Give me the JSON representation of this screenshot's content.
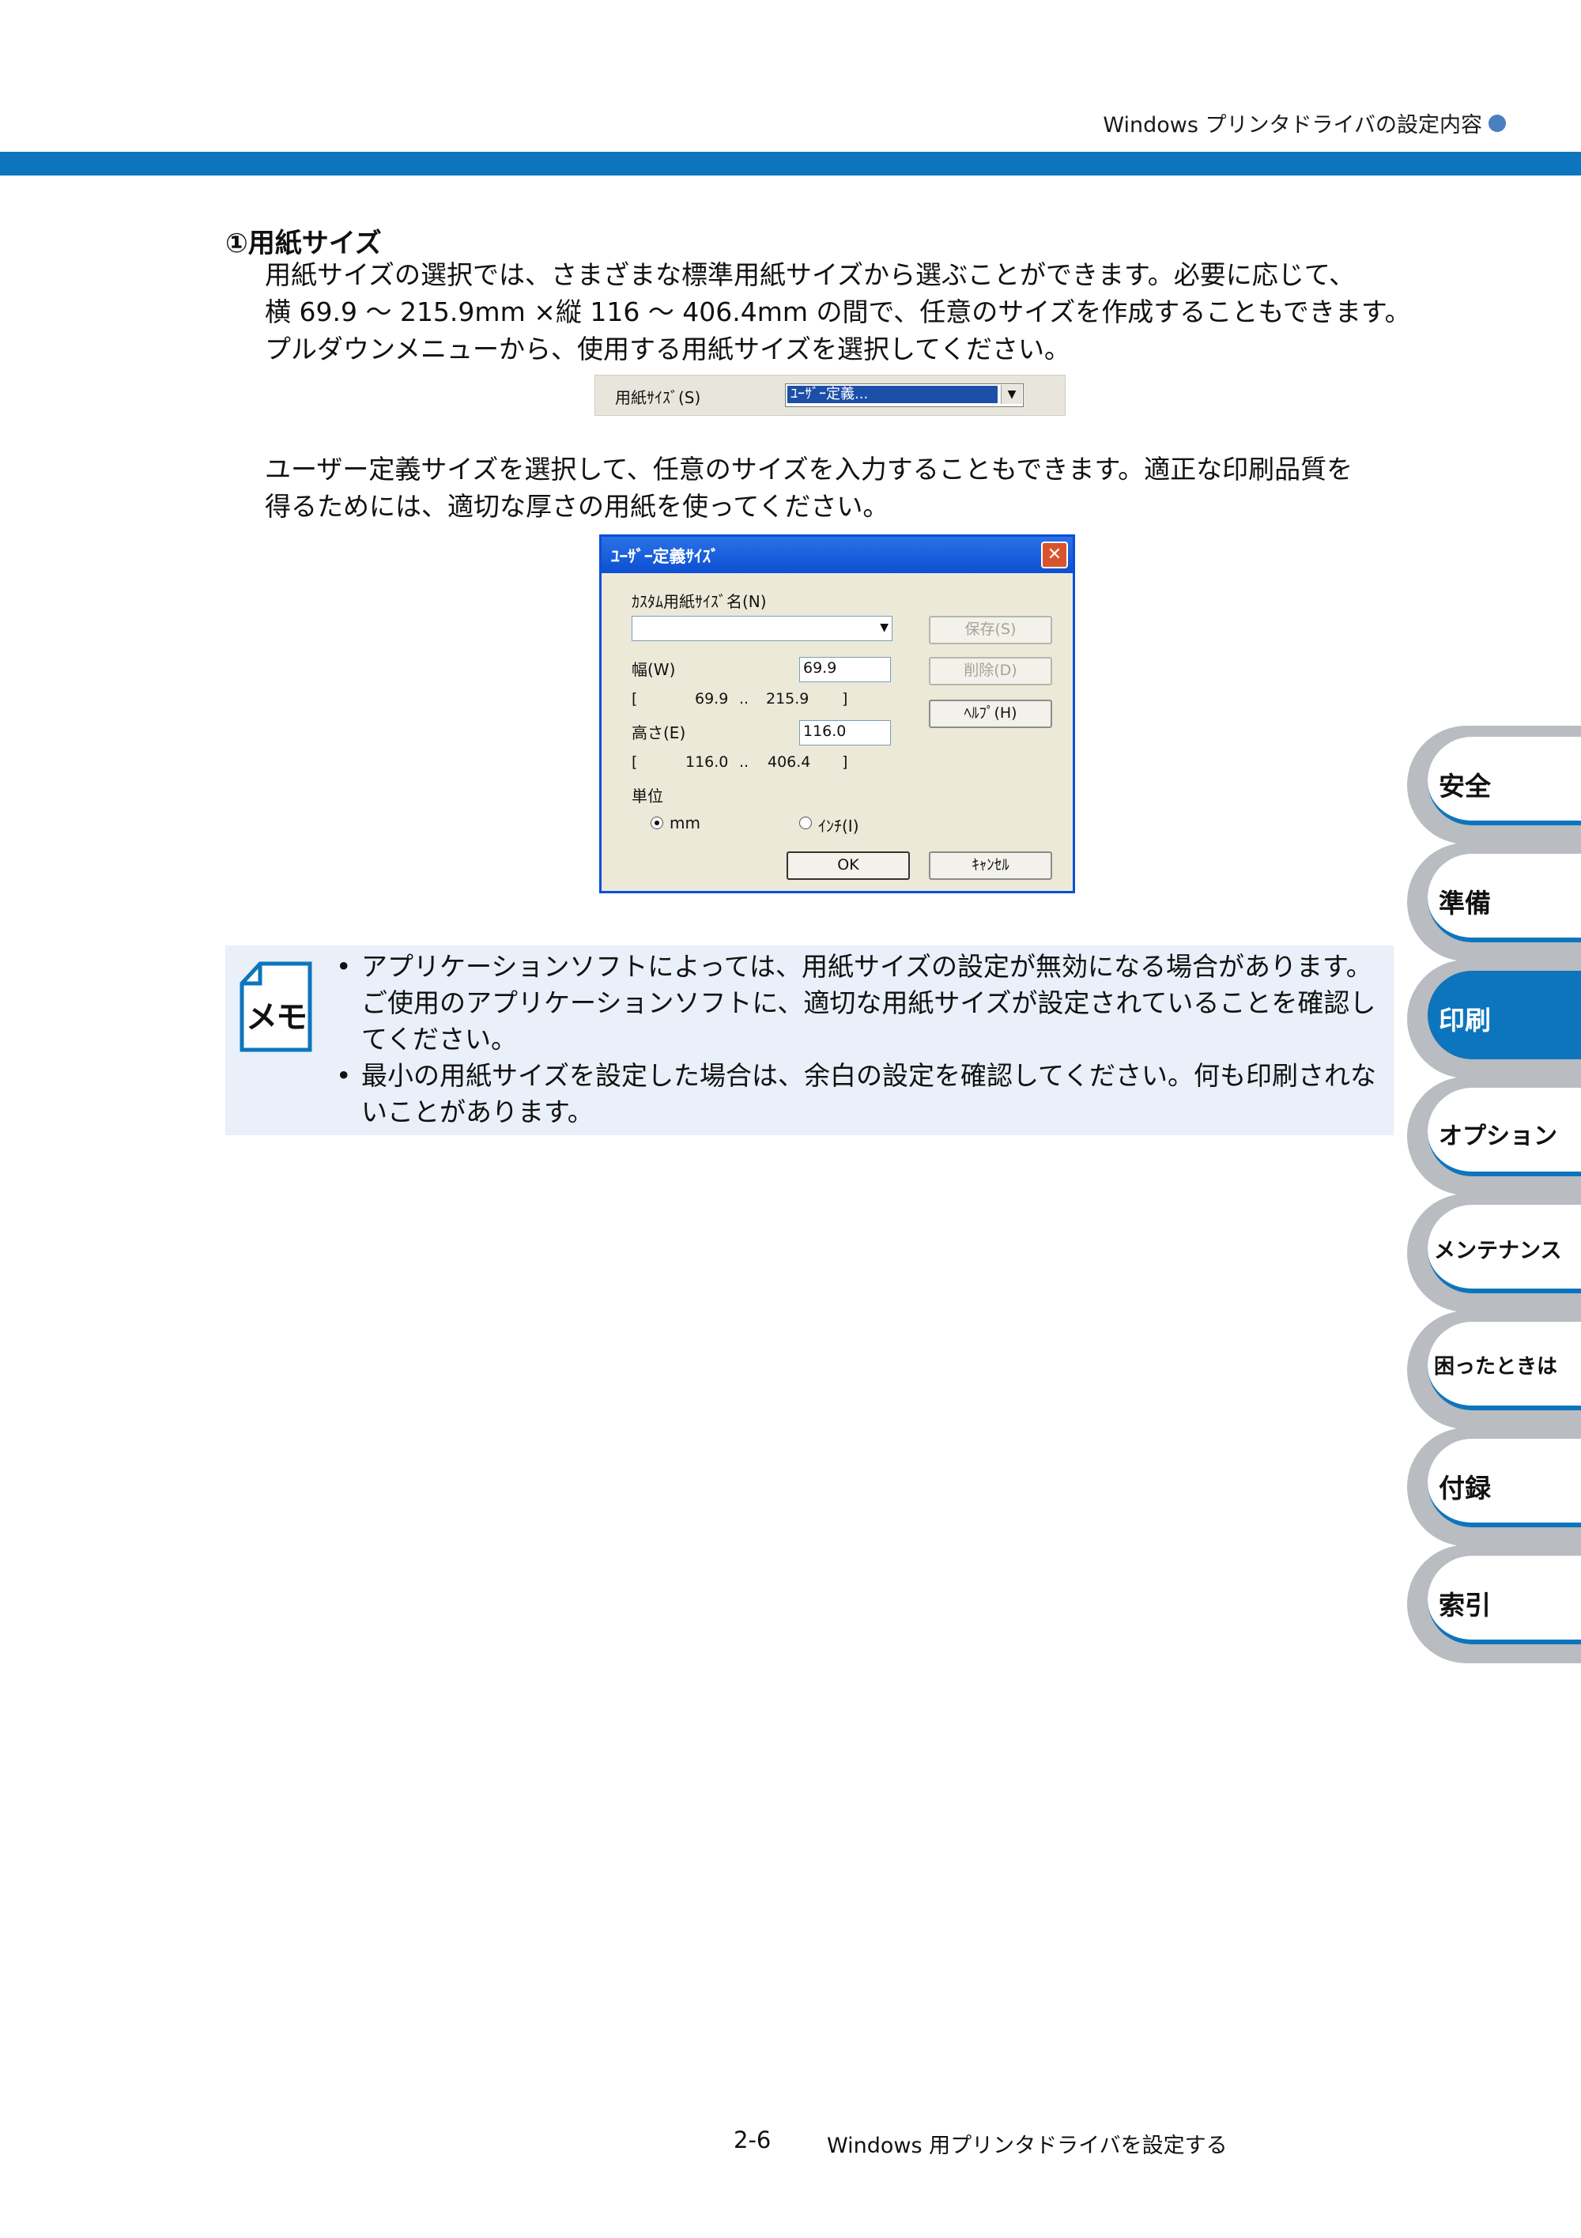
{
  "header": {
    "title": "Windows プリンタドライバの設定内容"
  },
  "section": {
    "title": "①用紙サイズ",
    "paragraph1": [
      "用紙サイズの選択では、さまざまな標準用紙サイズから選ぶことができます。必要に応じて、",
      "横 69.9 〜 215.9mm ×縦 116 〜 406.4mm の間で、任意のサイズを作成することもできます。",
      "プルダウンメニューから、使用する用紙サイズを選択してください。"
    ],
    "paragraph2": [
      "ユーザー定義サイズを選択して、任意のサイズを入力することもできます。適正な印刷品質を",
      "得るためには、適切な厚さの用紙を使ってください。"
    ]
  },
  "paper_size_control": {
    "label": "用紙ｻｲｽﾞ(S)",
    "value": "ﾕｰｻﾞｰ定義..."
  },
  "dialog": {
    "title": "ﾕｰｻﾞｰ定義ｻｲｽﾞ",
    "custom_name_label": "ｶｽﾀﾑ用紙ｻｲｽﾞ名(N)",
    "custom_name_value": "",
    "width_label": "幅(W)",
    "width_value": "69.9",
    "width_range_open": "[",
    "width_range_min": "69.9",
    "width_range_sep": "..",
    "width_range_max": "215.9",
    "width_range_close": "]",
    "height_label": "高さ(E)",
    "height_value": "116.0",
    "height_range_open": "[",
    "height_range_min": "116.0",
    "height_range_sep": "..",
    "height_range_max": "406.4",
    "height_range_close": "]",
    "unit_label": "単位",
    "unit_mm": "mm",
    "unit_inch": "ｲﾝﾁ(I)",
    "unit_selected": "mm",
    "save_button": "保存(S)",
    "delete_button": "削除(D)",
    "help_button": "ﾍﾙﾌﾟ(H)",
    "ok_button": "OK",
    "cancel_button": "ｷｬﾝｾﾙ"
  },
  "memo": {
    "icon_text": "メモ",
    "bullet": "•",
    "item1": [
      "アプリケーションソフトによっては、用紙サイズの設定が無効になる場合があります。",
      "ご使用のアプリケーションソフトに、適切な用紙サイズが設定されていることを確認し",
      "てください。"
    ],
    "item2": [
      "最小の用紙サイズを設定した場合は、余白の設定を確認してください。何も印刷されな",
      "いことがあります。"
    ]
  },
  "side_tabs": [
    "安全",
    "準備",
    "印刷",
    "オプション",
    "メンテナンス",
    "困ったときは",
    "付録",
    "索引"
  ],
  "active_tab": "印刷",
  "colors": {
    "accent": "#0d75bd",
    "tab_gray": "#b9bcc0",
    "memo_bg": "#e9f0f9"
  },
  "footer": {
    "page": "2-6",
    "title": "Windows 用プリンタドライバを設定する"
  }
}
